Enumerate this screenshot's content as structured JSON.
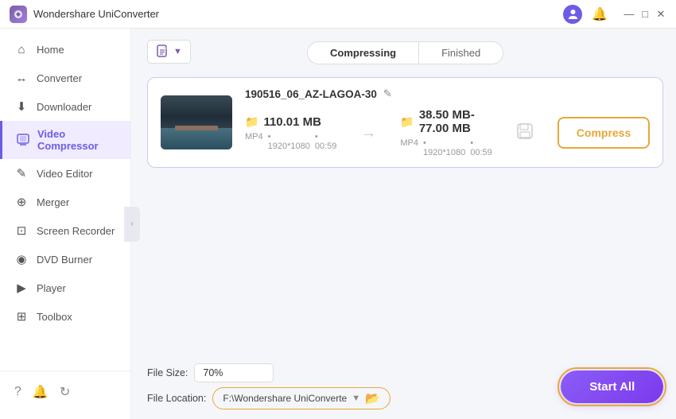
{
  "titleBar": {
    "appName": "Wondershare UniConverter",
    "userIcon": "U",
    "bellIcon": "🔔"
  },
  "sidebar": {
    "items": [
      {
        "id": "home",
        "label": "Home",
        "icon": "⌂"
      },
      {
        "id": "converter",
        "label": "Converter",
        "icon": "↔"
      },
      {
        "id": "downloader",
        "label": "Downloader",
        "icon": "↓"
      },
      {
        "id": "video-compressor",
        "label": "Video Compressor",
        "icon": "▣",
        "active": true
      },
      {
        "id": "video-editor",
        "label": "Video Editor",
        "icon": "✎"
      },
      {
        "id": "merger",
        "label": "Merger",
        "icon": "⊕"
      },
      {
        "id": "screen-recorder",
        "label": "Screen Recorder",
        "icon": "⊡"
      },
      {
        "id": "dvd-burner",
        "label": "DVD Burner",
        "icon": "◉"
      },
      {
        "id": "player",
        "label": "Player",
        "icon": "▶"
      },
      {
        "id": "toolbox",
        "label": "Toolbox",
        "icon": "⊞"
      }
    ],
    "bottomIcons": [
      "?",
      "🔔",
      "↻"
    ]
  },
  "tabs": {
    "compressing": "Compressing",
    "finished": "Finished",
    "active": "compressing"
  },
  "addFileBtn": {
    "label": "▼"
  },
  "fileCard": {
    "fileName": "190516_06_AZ-LAGOA-30",
    "sourceSize": "110.01 MB",
    "sourceMeta": [
      "MP4",
      "1920*1080",
      "00:59"
    ],
    "targetSize": "38.50 MB-77.00 MB",
    "targetMeta": [
      "MP4",
      "1920*1080",
      "00:59"
    ],
    "compressBtnLabel": "Compress"
  },
  "bottomBar": {
    "fileSizeLabel": "File Size:",
    "fileSizeValue": "70%",
    "fileLocationLabel": "File Location:",
    "fileLocationPath": "F:\\Wondershare UniConverte",
    "startAllLabel": "Start All"
  },
  "windowControls": {
    "minimize": "—",
    "maximize": "□",
    "close": "✕"
  }
}
